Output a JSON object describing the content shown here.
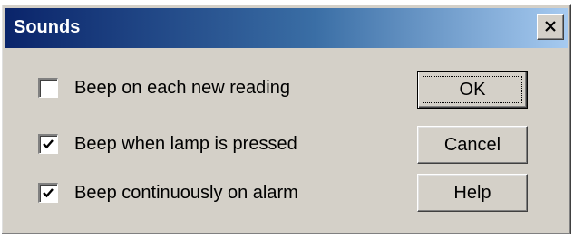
{
  "window": {
    "title": "Sounds",
    "close_icon": "close-icon"
  },
  "options": [
    {
      "label": "Beep on each new reading",
      "checked": false
    },
    {
      "label": "Beep when lamp is pressed",
      "checked": true
    },
    {
      "label": "Beep continuously on alarm",
      "checked": true
    }
  ],
  "buttons": {
    "ok": "OK",
    "cancel": "Cancel",
    "help": "Help"
  },
  "colors": {
    "face": "#d4d0c8",
    "title_start": "#0a246a",
    "title_end": "#a6caf0"
  }
}
